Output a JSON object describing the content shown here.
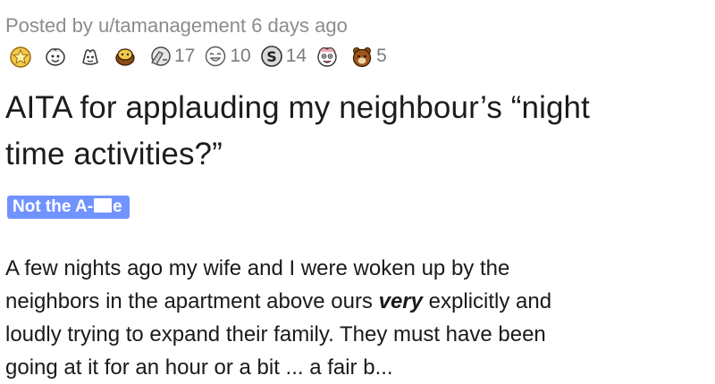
{
  "post": {
    "posted_by_prefix": "Posted by ",
    "username": "u/tamanagement",
    "time_ago": "6 days ago",
    "awards": [
      {
        "icon": "gold-medal-icon",
        "count": ""
      },
      {
        "icon": "wholesome-face-icon",
        "count": ""
      },
      {
        "icon": "helpful-hand-icon",
        "count": ""
      },
      {
        "icon": "hug-bear-icon",
        "count": ""
      },
      {
        "icon": "face-palm-icon",
        "count": "17"
      },
      {
        "icon": "laughing-face-icon",
        "count": "10"
      },
      {
        "icon": "silver-s-icon",
        "count": "14"
      },
      {
        "icon": "crazy-face-icon",
        "count": ""
      },
      {
        "icon": "bear-icon",
        "count": "5"
      }
    ],
    "title_line1": "AITA for applauding my neighbour’s “night",
    "title_line2": "time activities?”",
    "flair_prefix": "Not the A-",
    "flair_suffix": "e",
    "body_line1": "A few nights ago my wife and I were woken up by the",
    "body_line2_before": "neighbors in the apartment above ours ",
    "body_line2_emph": "very",
    "body_line2_after": " explicitly and",
    "body_line3": "loudly trying to expand their family. They must have been",
    "body_line4": "going at it for an hour or a bit ... a fair b..."
  },
  "colors": {
    "flair_bg": "#7193ff",
    "meta_text": "#8a8c8e",
    "body_text": "#1a1a1b"
  }
}
